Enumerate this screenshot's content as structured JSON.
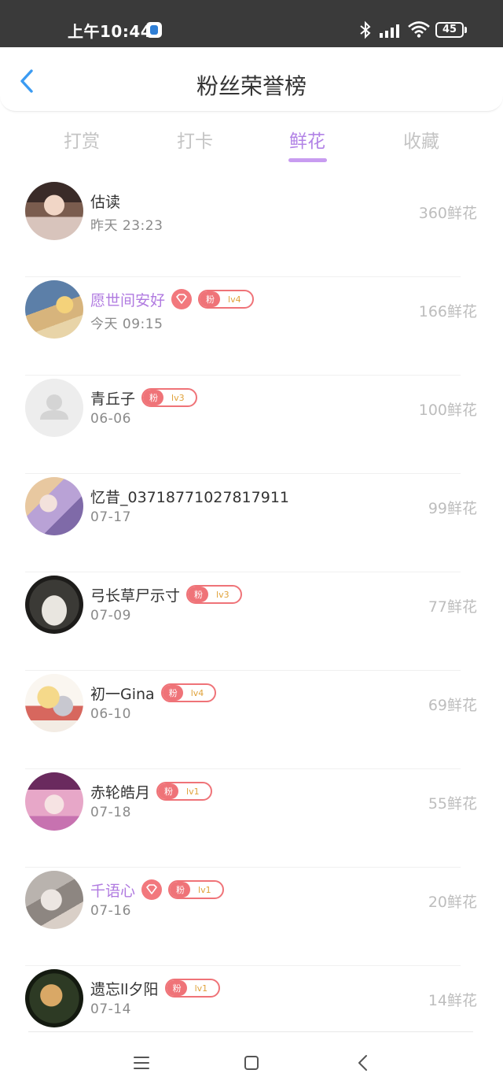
{
  "status_bar": {
    "time": "上午10:44",
    "battery": "45"
  },
  "header": {
    "title": "粉丝荣誉榜"
  },
  "tabs": [
    {
      "label": "打赏",
      "active": false
    },
    {
      "label": "打卡",
      "active": false
    },
    {
      "label": "鲜花",
      "active": true
    },
    {
      "label": "收藏",
      "active": false
    }
  ],
  "colors": {
    "accent": "#b283e6",
    "badge": "#ef7378",
    "amount": "#bdbdbd"
  },
  "fans": [
    {
      "name": "估读",
      "time": "昨天 23:23",
      "amount": "360鲜花",
      "vip": false,
      "diamond": false,
      "badge": null
    },
    {
      "name": "愿世间安好",
      "time": "今天 09:15",
      "amount": "166鲜花",
      "vip": true,
      "diamond": true,
      "badge": {
        "tag": "粉",
        "level": "lv4"
      }
    },
    {
      "name": "青丘子",
      "time": "06-06",
      "amount": "100鲜花",
      "vip": false,
      "diamond": false,
      "badge": {
        "tag": "粉",
        "level": "lv3"
      }
    },
    {
      "name": "忆昔_037187710278179​11",
      "time": "07-17",
      "amount": "99鲜花",
      "vip": false,
      "diamond": false,
      "badge": null
    },
    {
      "name": "弓长草尸示寸",
      "time": "07-09",
      "amount": "77鲜花",
      "vip": false,
      "diamond": false,
      "badge": {
        "tag": "粉",
        "level": "lv3"
      }
    },
    {
      "name": "初一Gina",
      "time": "06-10",
      "amount": "69鲜花",
      "vip": false,
      "diamond": false,
      "badge": {
        "tag": "粉",
        "level": "lv4"
      }
    },
    {
      "name": "赤轮皓月",
      "time": "07-18",
      "amount": "55鲜花",
      "vip": false,
      "diamond": false,
      "badge": {
        "tag": "粉",
        "level": "lv1"
      }
    },
    {
      "name": "千语心",
      "time": "07-16",
      "amount": "20鲜花",
      "vip": true,
      "diamond": true,
      "badge": {
        "tag": "粉",
        "level": "lv1"
      }
    },
    {
      "name": "遗忘ll夕阳",
      "time": "07-14",
      "amount": "14鲜花",
      "vip": false,
      "diamond": false,
      "badge": {
        "tag": "粉",
        "level": "lv1"
      }
    }
  ]
}
